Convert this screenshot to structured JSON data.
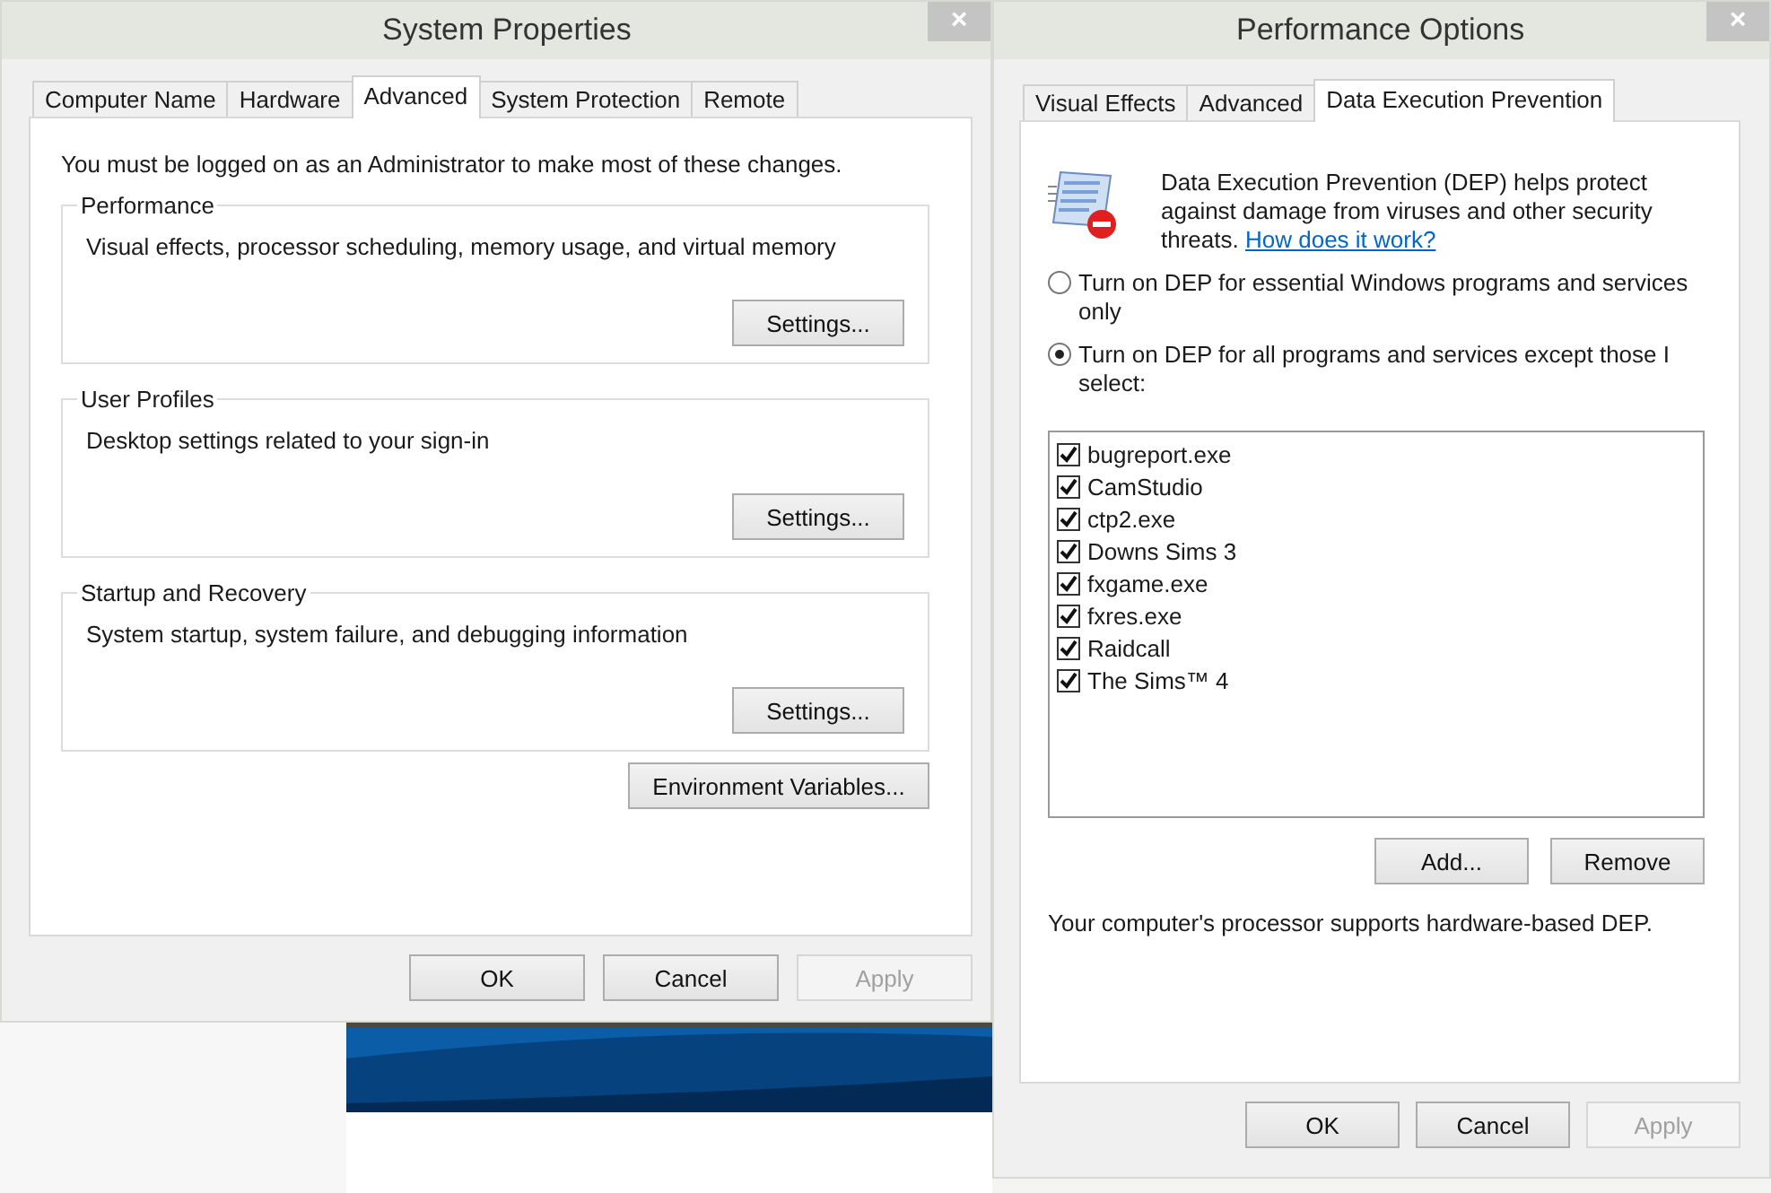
{
  "system_properties": {
    "title": "System Properties",
    "close": "×",
    "tabs": [
      {
        "label": "Computer Name",
        "selected": false
      },
      {
        "label": "Hardware",
        "selected": false
      },
      {
        "label": "Advanced",
        "selected": true
      },
      {
        "label": "System Protection",
        "selected": false
      },
      {
        "label": "Remote",
        "selected": false
      }
    ],
    "notice": "You must be logged on as an Administrator to make most of these changes.",
    "groups": [
      {
        "title": "Performance",
        "description": "Visual effects, processor scheduling, memory usage, and virtual memory",
        "button": "Settings..."
      },
      {
        "title": "User Profiles",
        "description": "Desktop settings related to your sign-in",
        "button": "Settings..."
      },
      {
        "title": "Startup and Recovery",
        "description": "System startup, system failure, and debugging information",
        "button": "Settings..."
      }
    ],
    "environment_button": "Environment Variables...",
    "buttons": [
      {
        "label": "OK",
        "disabled": false
      },
      {
        "label": "Cancel",
        "disabled": false
      },
      {
        "label": "Apply",
        "disabled": true
      }
    ]
  },
  "performance_options": {
    "title": "Performance Options",
    "close": "×",
    "tabs": [
      {
        "label": "Visual Effects",
        "selected": false
      },
      {
        "label": "Advanced",
        "selected": false
      },
      {
        "label": "Data Execution Prevention",
        "selected": true
      }
    ],
    "description": "Data Execution Prevention (DEP) helps protect against damage from viruses and other security threats.",
    "link": "How does it work?",
    "options": [
      {
        "label": "Turn on DEP for essential Windows programs and services only",
        "selected": false
      },
      {
        "label": "Turn on DEP for all programs and services except those I select:",
        "selected": true
      }
    ],
    "programs": [
      {
        "name": "bugreport.exe",
        "checked": true
      },
      {
        "name": "CamStudio",
        "checked": true
      },
      {
        "name": "ctp2.exe",
        "checked": true
      },
      {
        "name": "Downs Sims 3",
        "checked": true
      },
      {
        "name": "fxgame.exe",
        "checked": true
      },
      {
        "name": "fxres.exe",
        "checked": true
      },
      {
        "name": "Raidcall",
        "checked": true
      },
      {
        "name": "The Sims™ 4",
        "checked": true
      }
    ],
    "list_buttons": [
      "Add...",
      "Remove"
    ],
    "support_note": "Your computer's processor supports hardware-based DEP.",
    "buttons": [
      {
        "label": "OK",
        "disabled": false
      },
      {
        "label": "Cancel",
        "disabled": false
      },
      {
        "label": "Apply",
        "disabled": true
      }
    ]
  }
}
